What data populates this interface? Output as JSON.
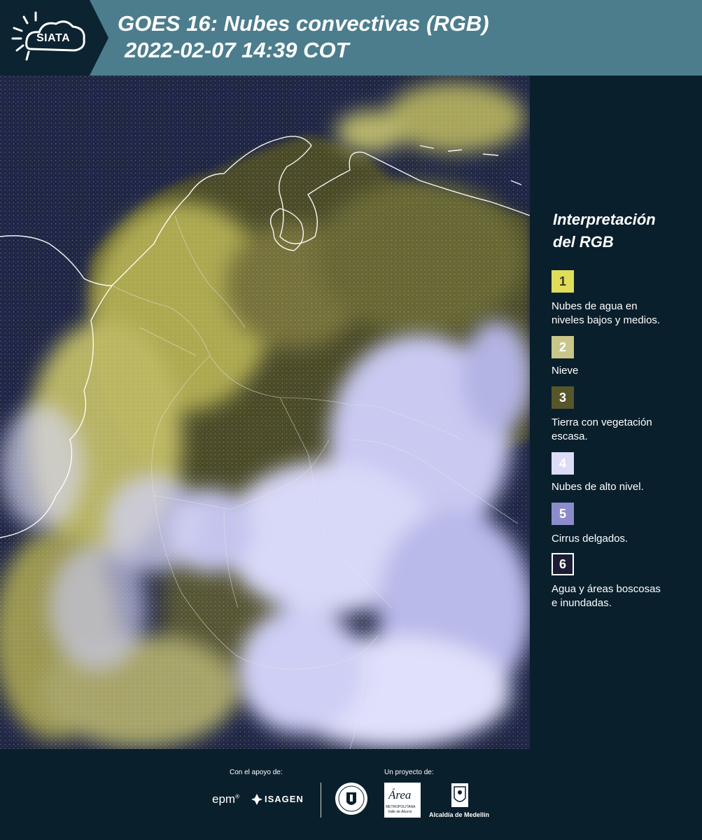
{
  "header": {
    "logo_text": "SIATA",
    "title_line1": "GOES 16: Nubes convectivas (RGB)",
    "title_line2": "2022-02-07 14:39 COT"
  },
  "legend": {
    "title_line1": "Interpretación",
    "title_line2": "del RGB",
    "items": [
      {
        "number": "1",
        "color": "#e0dd5a",
        "text_color": "#3a3a20",
        "label_line1": "Nubes de agua en",
        "label_line2": "niveles bajos y medios."
      },
      {
        "number": "2",
        "color": "#c9c68a",
        "text_color": "#ffffff",
        "label_line1": "Nieve",
        "label_line2": ""
      },
      {
        "number": "3",
        "color": "#56562a",
        "text_color": "#ffffff",
        "label_line1": "Tierra con vegetación",
        "label_line2": "escasa."
      },
      {
        "number": "4",
        "color": "#dcdcf8",
        "text_color": "#ffffff",
        "label_line1": "Nubes de alto nivel.",
        "label_line2": ""
      },
      {
        "number": "5",
        "color": "#8c8ccc",
        "text_color": "#ffffff",
        "label_line1": "Cirrus delgados.",
        "label_line2": ""
      },
      {
        "number": "6",
        "color": "#1c1c34",
        "text_color": "#ffffff",
        "label_line1": "Agua y áreas boscosas",
        "label_line2": "e inundadas."
      }
    ]
  },
  "footer": {
    "support_label": "Con el apoyo de:",
    "project_label": "Un proyecto de:",
    "epm_text": "epm",
    "isagen_text": "ISAGEN",
    "metro_text": "METROPOLITANA",
    "metro_sub": "Valle de Aburrá",
    "area_text": "Área",
    "alcaldia_text": "Alcaldía de Medellín"
  }
}
